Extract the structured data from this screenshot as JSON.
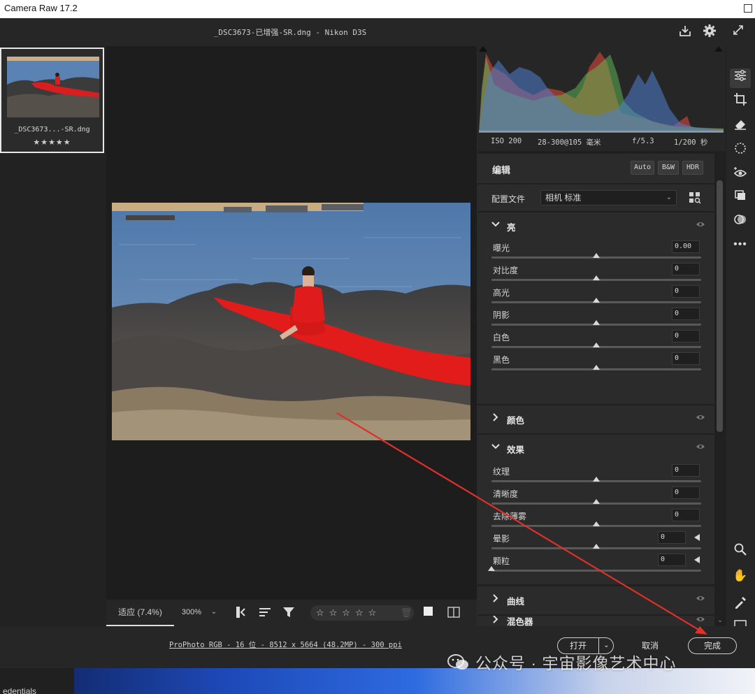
{
  "window": {
    "title": "Camera Raw 17.2"
  },
  "header": {
    "file_title": "_DSC3673-已增强-SR.dng -  Nikon D3S"
  },
  "filmstrip": {
    "thumb_name": "_DSC3673...-SR.dng",
    "thumb_stars": "★★★★★"
  },
  "histogram": {
    "iso": "ISO 200",
    "lens": "28-300@105 毫米",
    "aperture": "f/5.3",
    "shutter": "1/200 秒"
  },
  "edit": {
    "title": "编辑",
    "auto": "Auto",
    "bw": "B&W",
    "hdr": "HDR"
  },
  "profile": {
    "label": "配置文件",
    "value": "相机 标准"
  },
  "light": {
    "title": "亮",
    "sliders": [
      {
        "label": "曝光",
        "value": "0.00",
        "level": 0.5
      },
      {
        "label": "对比度",
        "value": "0",
        "level": 0.5
      },
      {
        "label": "高光",
        "value": "0",
        "level": 0.5
      },
      {
        "label": "阴影",
        "value": "0",
        "level": 0.5
      },
      {
        "label": "白色",
        "value": "0",
        "level": 0.5
      },
      {
        "label": "黑色",
        "value": "0",
        "level": 0.5
      }
    ]
  },
  "color": {
    "title": "颜色"
  },
  "effects": {
    "title": "效果",
    "sliders": [
      {
        "label": "纹理",
        "value": "0",
        "level": 0.5
      },
      {
        "label": "清晰度",
        "value": "0",
        "level": 0.5
      },
      {
        "label": "去除薄雾",
        "value": "0",
        "level": 0.5
      },
      {
        "label": "晕影",
        "value": "0",
        "level": 0.5
      },
      {
        "label": "颗粒",
        "value": "0",
        "level": 0.0
      }
    ]
  },
  "curve": {
    "title": "曲线"
  },
  "mixer": {
    "title": "混色器"
  },
  "viewbar": {
    "fit": "适应 (7.4%)",
    "zoom": "300%",
    "rating": "☆☆☆☆☆"
  },
  "footer": {
    "specs": "ProPhoto RGB - 16 位 - 8512 x 5664 (48.2MP) - 300 ppi",
    "open": "打开",
    "cancel": "取消",
    "done": "完成"
  },
  "desktop": {
    "snippet": "edentials"
  },
  "watermark": {
    "text": "公众号 · 宇宙影像艺术中心"
  },
  "colors": {
    "annotation_arrow": "#e0302a",
    "panel": "#2b2b2b",
    "canvas": "#1d1d1d"
  }
}
